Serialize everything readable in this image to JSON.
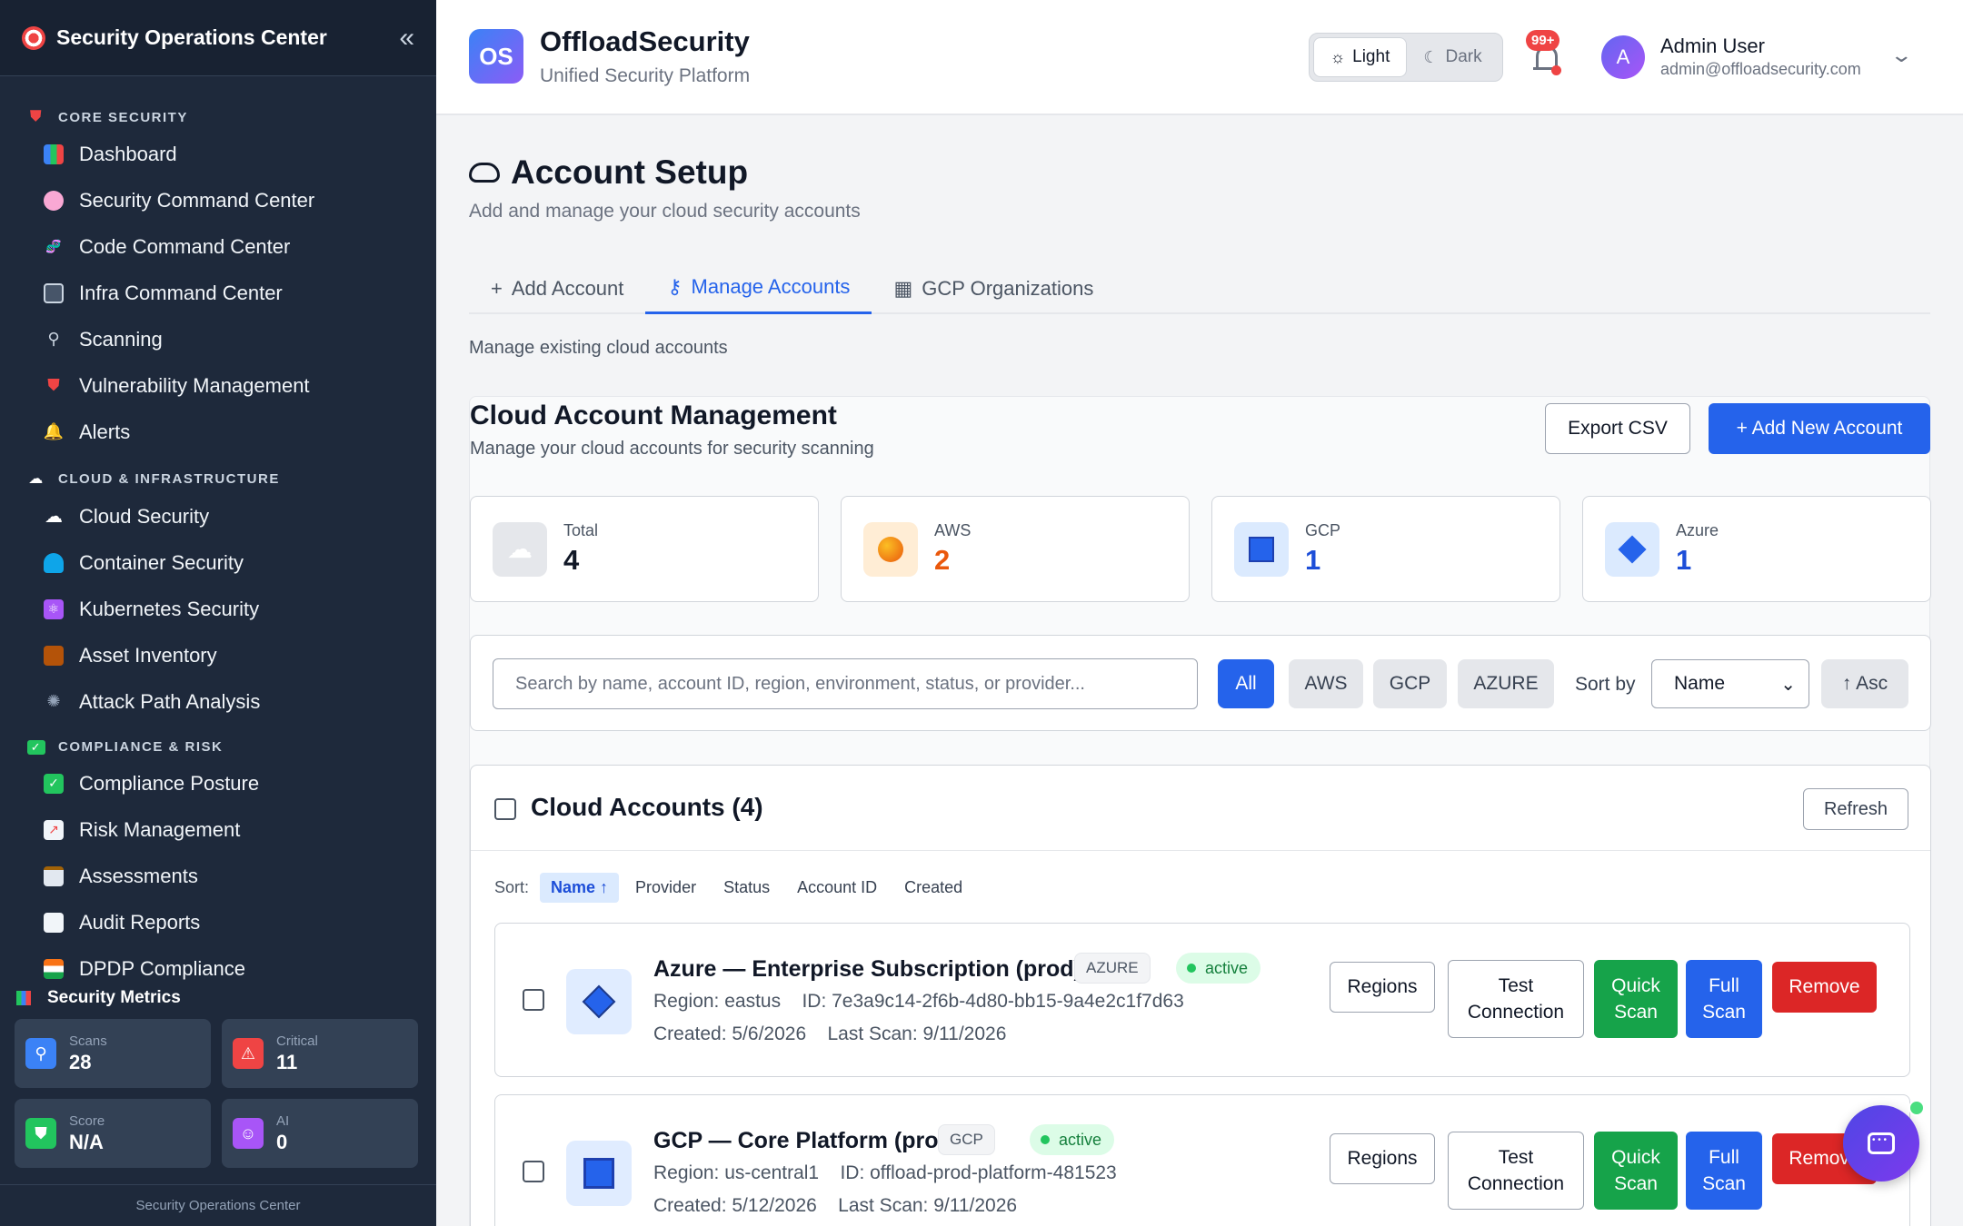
{
  "sidebar": {
    "title": "Security Operations Center",
    "sections": [
      {
        "label": "CORE SECURITY",
        "items": [
          "Dashboard",
          "Security Command Center",
          "Code Command Center",
          "Infra Command Center",
          "Scanning",
          "Vulnerability Management",
          "Alerts"
        ]
      },
      {
        "label": "CLOUD & INFRASTRUCTURE",
        "items": [
          "Cloud Security",
          "Container Security",
          "Kubernetes Security",
          "Asset Inventory",
          "Attack Path Analysis"
        ]
      },
      {
        "label": "COMPLIANCE & RISK",
        "items": [
          "Compliance Posture",
          "Risk Management",
          "Assessments",
          "Audit Reports",
          "DPDP Compliance"
        ]
      }
    ],
    "metrics_title": "Security Metrics",
    "metrics": [
      {
        "label": "Scans",
        "value": "28"
      },
      {
        "label": "Critical",
        "value": "11"
      },
      {
        "label": "Score",
        "value": "N/A"
      },
      {
        "label": "AI",
        "value": "0"
      }
    ],
    "footer": "Security Operations Center"
  },
  "topbar": {
    "logo_text": "OS",
    "brand": "OffloadSecurity",
    "tagline": "Unified Security Platform",
    "theme_light": "Light",
    "theme_dark": "Dark",
    "notifications": "99+",
    "avatar_initial": "A",
    "user_name": "Admin User",
    "user_email": "admin@offloadsecurity.com"
  },
  "page": {
    "title": "Account Setup",
    "subtitle": "Add and manage your cloud security accounts",
    "tabs": [
      "Add Account",
      "Manage Accounts",
      "GCP Organizations"
    ],
    "tab_desc": "Manage existing cloud accounts"
  },
  "panel": {
    "title": "Cloud Account Management",
    "subtitle": "Manage your cloud accounts for security scanning",
    "export": "Export CSV",
    "add": "+ Add New Account",
    "stats": [
      {
        "label": "Total",
        "value": "4",
        "color": "#111827"
      },
      {
        "label": "AWS",
        "value": "2",
        "color": "#ea580c"
      },
      {
        "label": "GCP",
        "value": "1",
        "color": "#1d4ed8"
      },
      {
        "label": "Azure",
        "value": "1",
        "color": "#1d4ed8"
      }
    ],
    "search_placeholder": "Search by name, account ID, region, environment, status, or provider...",
    "filters": [
      "All",
      "AWS",
      "GCP",
      "AZURE"
    ],
    "sort_label": "Sort by",
    "sort_value": "Name",
    "sort_dir": "↑ Asc"
  },
  "list": {
    "title": "Cloud Accounts (4)",
    "refresh": "Refresh",
    "sort_prefix": "Sort:",
    "sort_options": [
      "Name ↑",
      "Provider",
      "Status",
      "Account ID",
      "Created"
    ],
    "accounts": [
      {
        "name": "Azure — Enterprise Subscription (prod)",
        "provider": "AZURE",
        "status": "active",
        "region": "Region: eastus",
        "id": "ID: 7e3a9c14-2f6b-4d80-bb15-9a4e2c1f7d63",
        "created": "Created: 5/6/2026",
        "last_scan": "Last Scan: 9/11/2026"
      },
      {
        "name": "GCP — Core Platform (prod)",
        "provider": "GCP",
        "status": "active",
        "region": "Region: us-central1",
        "id": "ID: offload-prod-platform-481523",
        "created": "Created: 5/12/2026",
        "last_scan": "Last Scan: 9/11/2026"
      }
    ],
    "actions": {
      "regions": "Regions",
      "test_1": "Test",
      "test_2": "Connection",
      "quick_1": "Quick",
      "quick_2": "Scan",
      "full_1": "Full",
      "full_2": "Scan",
      "remove": "Remove"
    }
  },
  "colors": {
    "sidebar_bg": "#1e293b",
    "primary": "#2563eb",
    "success": "#16a34a",
    "danger": "#dc2626"
  }
}
